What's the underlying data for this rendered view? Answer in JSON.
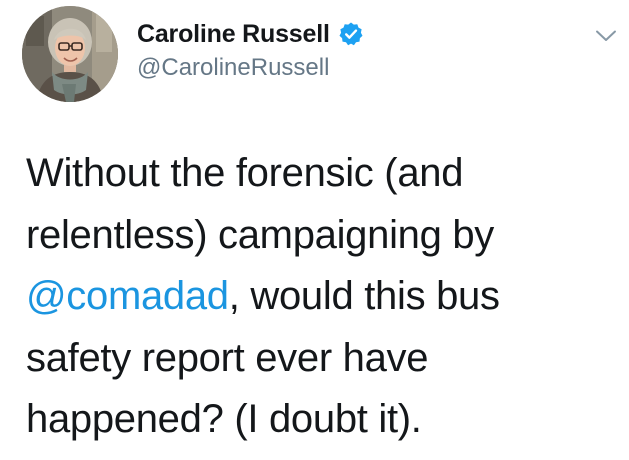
{
  "author": {
    "display_name": "Caroline Russell",
    "handle": "@CarolineRussell",
    "verified": true,
    "avatar": "profile-photo"
  },
  "icons": {
    "verified_badge": "verified-badge-icon",
    "more_menu": "chevron-down-icon"
  },
  "tweet": {
    "line1": "Without the forensic (and",
    "line2": "relentless) campaigning by",
    "mention": "@comadad",
    "line3_rest": ", would this bus",
    "line4": "safety report ever have",
    "line5": "happened? (I doubt it)."
  },
  "colors": {
    "text": "#14171a",
    "handle": "#657786",
    "mention": "#1b95e0",
    "verified": "#1da1f2",
    "caret": "#8899a6"
  }
}
